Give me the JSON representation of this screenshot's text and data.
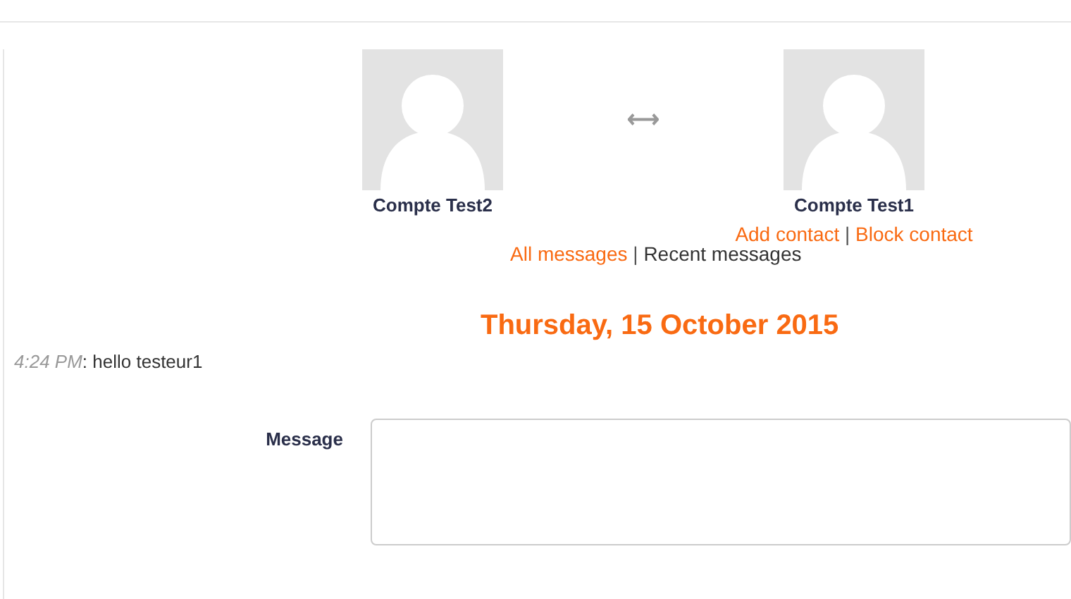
{
  "profiles": [
    {
      "name": "Compte Test2"
    },
    {
      "name": "Compte Test1",
      "links": [
        "Add contact",
        "Block contact"
      ]
    }
  ],
  "separator": "|",
  "switch_icon": "⟷",
  "views": [
    {
      "label": "All messages",
      "selected": false
    },
    {
      "label": "Recent messages",
      "selected": true
    }
  ],
  "date": "Thursday, 15 October 2015",
  "messages": [
    {
      "time": "4:24 PM",
      "text": ": hello testeur1"
    }
  ],
  "form": {
    "label": "Message"
  }
}
